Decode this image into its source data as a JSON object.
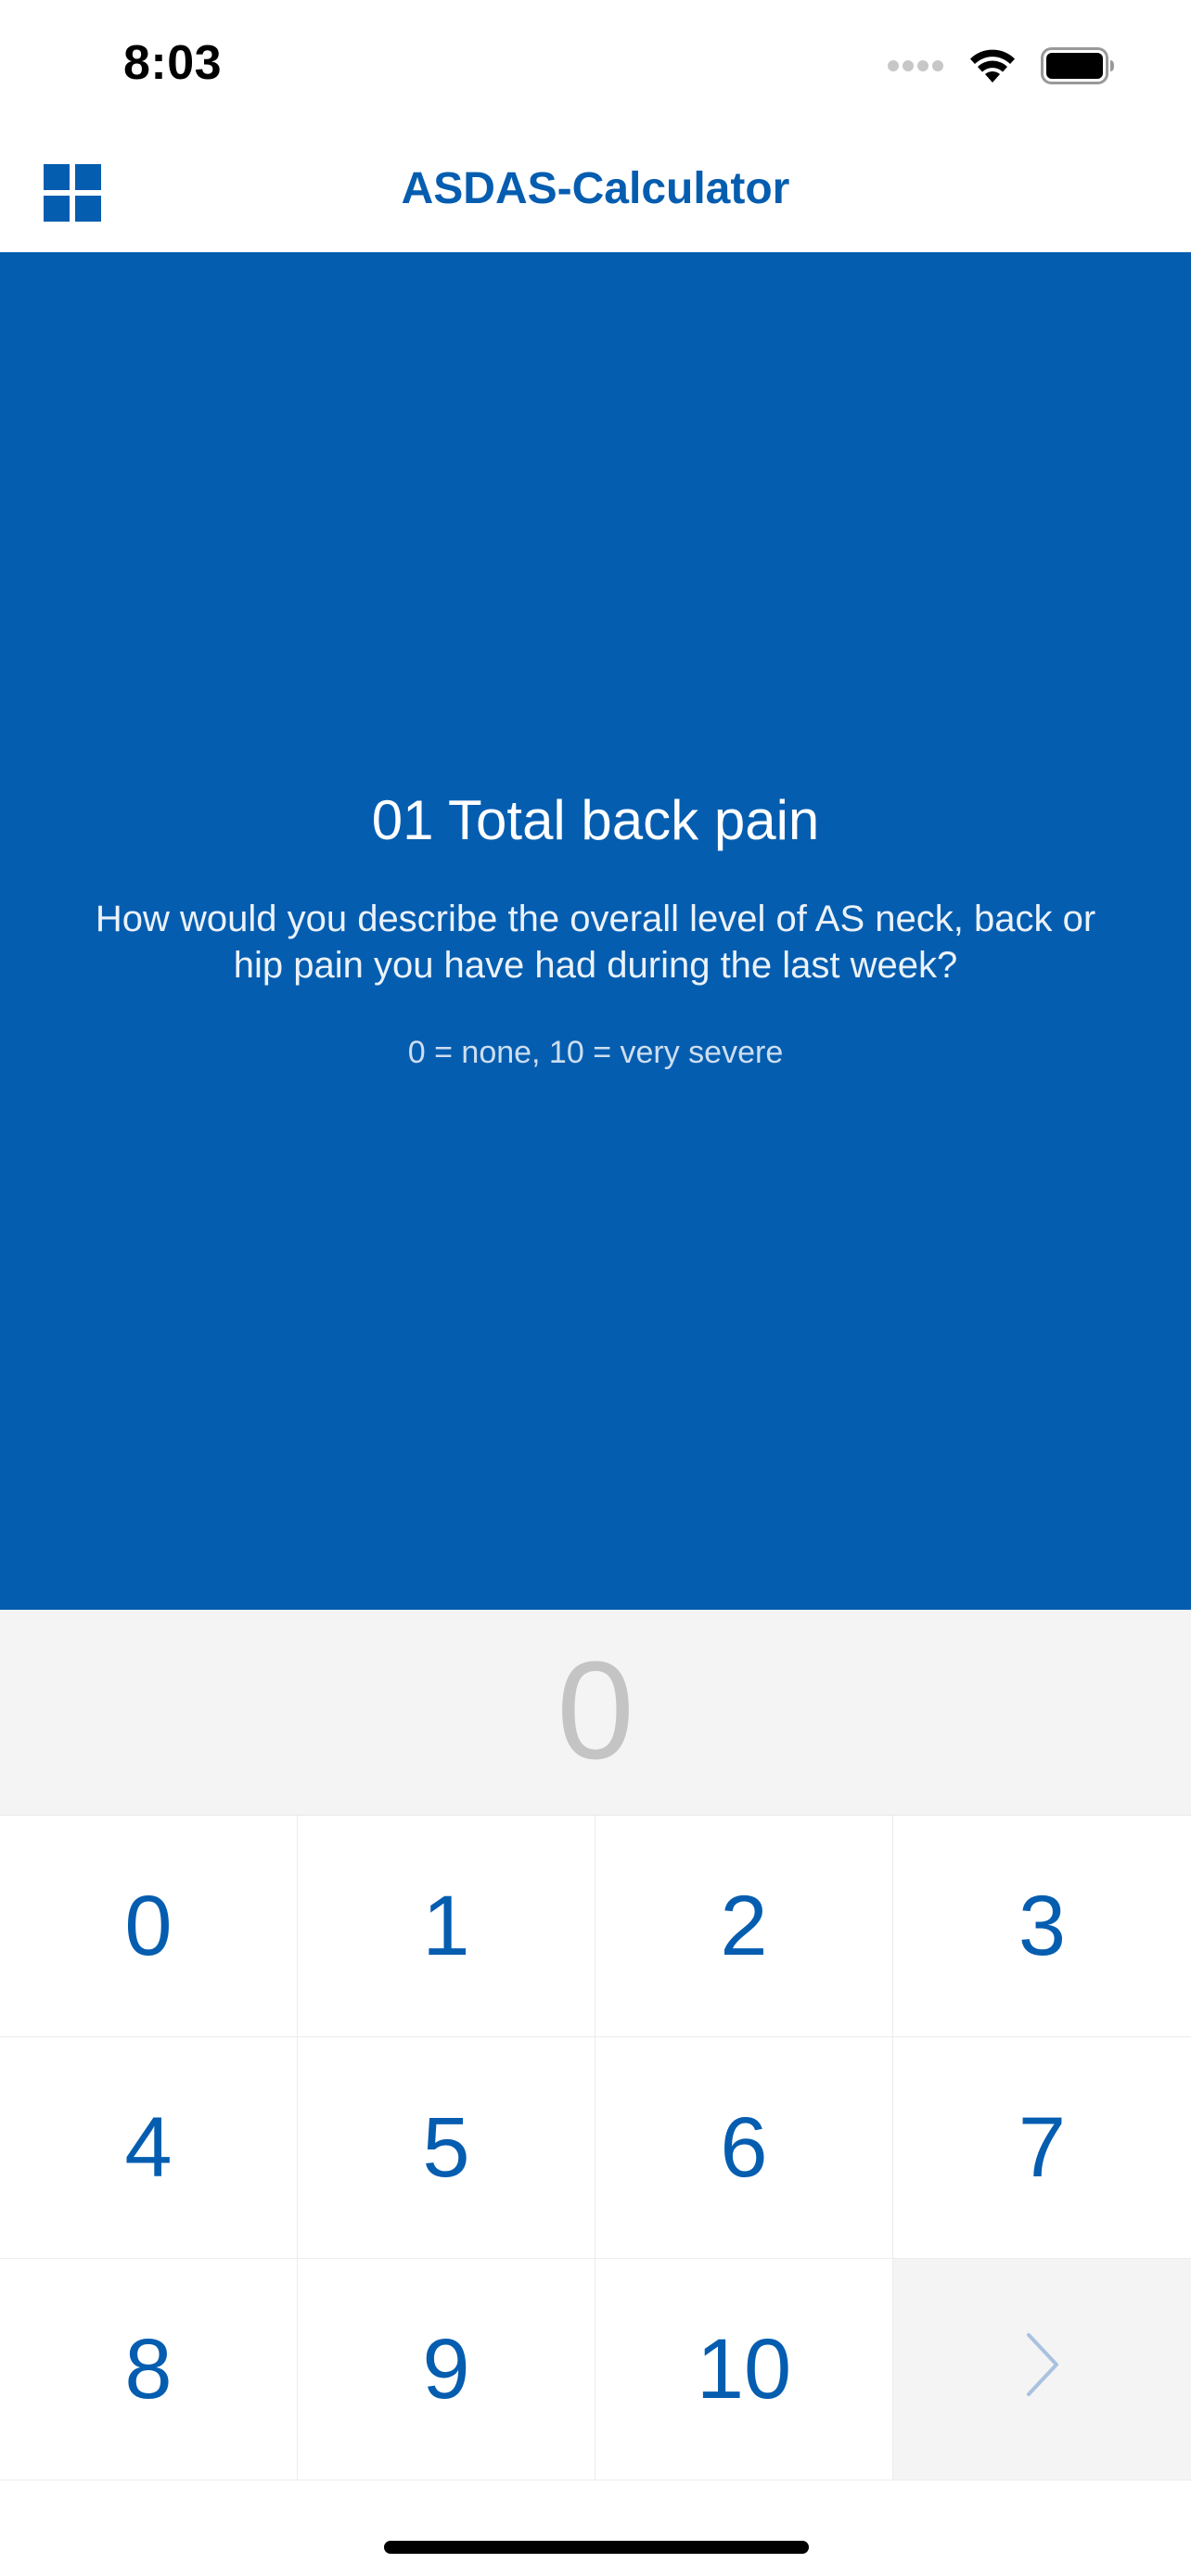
{
  "status_bar": {
    "time": "8:03"
  },
  "nav": {
    "title": "ASDAS-Calculator",
    "menu_icon": "grid-icon"
  },
  "question": {
    "title": "01 Total back pain",
    "text": "How would you describe the overall level of AS neck, back or hip pain you have had during the last week?",
    "scale": "0 = none, 10 = very severe"
  },
  "value_display": {
    "value": "0"
  },
  "keypad": {
    "keys": [
      "0",
      "1",
      "2",
      "3",
      "4",
      "5",
      "6",
      "7",
      "8",
      "9",
      "10"
    ],
    "next_icon": "chevron-right-icon"
  },
  "colors": {
    "accent": "#055db0",
    "value_grey": "#c4c4c4",
    "panel_grey": "#f4f4f4",
    "chevron_light": "#a9c2df"
  }
}
